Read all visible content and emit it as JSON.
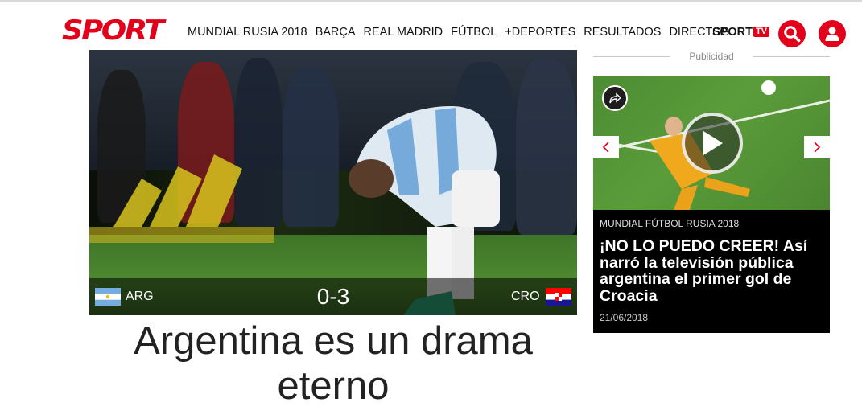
{
  "header": {
    "logo": "SPORT",
    "nav": [
      "MUNDIAL RUSIA 2018",
      "BARÇA",
      "REAL MADRID",
      "FÚTBOL",
      "+DEPORTES",
      "RESULTADOS",
      "DIRECTOS"
    ],
    "sporttv": {
      "part1": "SPORT",
      "part2": "TV"
    },
    "accent_color": "#e2001a"
  },
  "hero": {
    "home_team": "ARG",
    "away_team": "CRO",
    "score": "0-3",
    "headline": "Argentina es un drama eterno"
  },
  "sidebar": {
    "ad_label": "Publicidad",
    "video_card": {
      "category": "MUNDIAL FÚTBOL RUSIA 2018",
      "title": "¡NO LO PUEDO CREER! Así narró la televisión pública argentina el primer gol de Croacia",
      "date": "21/06/2018"
    }
  },
  "icons": {
    "search": "search-icon",
    "user": "user-icon",
    "share": "share-icon",
    "play": "play-icon",
    "prev": "chevron-left-icon",
    "next": "chevron-right-icon"
  }
}
